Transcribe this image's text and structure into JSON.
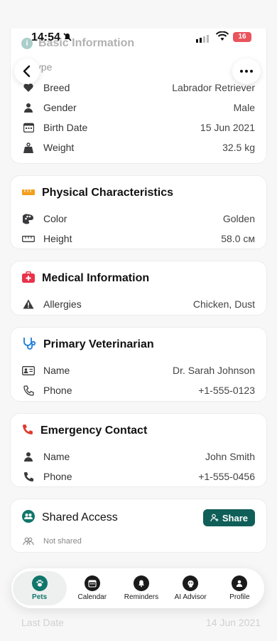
{
  "status": {
    "time": "14:54",
    "battery": "16"
  },
  "ghost": {
    "section_title": "Basic Information",
    "bottom_label": "Last Date",
    "bottom_value": "14 Jun 2021"
  },
  "basic": {
    "partial_label": "Type",
    "rows": [
      {
        "label": "Breed",
        "value": "Labrador Retriever"
      },
      {
        "label": "Gender",
        "value": "Male"
      },
      {
        "label": "Birth Date",
        "value": "15 Jun 2021"
      },
      {
        "label": "Weight",
        "value": "32.5 kg"
      }
    ]
  },
  "physical": {
    "title": "Physical Characteristics",
    "rows": [
      {
        "label": "Color",
        "value": "Golden"
      },
      {
        "label": "Height",
        "value": "58.0 см"
      }
    ]
  },
  "medical": {
    "title": "Medical Information",
    "rows": [
      {
        "label": "Allergies",
        "value": "Chicken, Dust"
      }
    ]
  },
  "vet": {
    "title": "Primary Veterinarian",
    "rows": [
      {
        "label": "Name",
        "value": "Dr. Sarah Johnson"
      },
      {
        "label": "Phone",
        "value": "+1-555-0123"
      }
    ]
  },
  "emergency": {
    "title": "Emergency Contact",
    "rows": [
      {
        "label": "Name",
        "value": "John Smith"
      },
      {
        "label": "Phone",
        "value": "+1-555-0456"
      }
    ]
  },
  "shared": {
    "title": "Shared Access",
    "share_label": "Share",
    "status": "Not shared"
  },
  "tabs": [
    {
      "label": "Pets"
    },
    {
      "label": "Calendar"
    },
    {
      "label": "Reminders"
    },
    {
      "label": "AI Advisor"
    },
    {
      "label": "Profile"
    }
  ],
  "colors": {
    "accent": "#11766b",
    "share_button": "#0f5e57",
    "medical": "#e8334a",
    "physical": "#f59e1b",
    "vet": "#1a7ddc",
    "emergency": "#e13a2e"
  }
}
